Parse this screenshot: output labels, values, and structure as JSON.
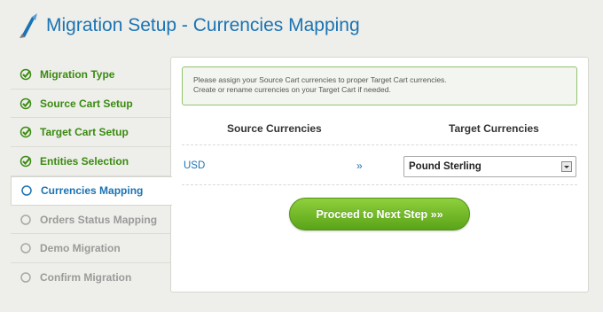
{
  "header": {
    "title": "Migration Setup - Currencies Mapping",
    "logo_icon": "arrow-pen-icon"
  },
  "steps": [
    {
      "label": "Migration Type",
      "state": "done",
      "icon": "check-circle-icon"
    },
    {
      "label": "Source Cart Setup",
      "state": "done",
      "icon": "check-circle-icon"
    },
    {
      "label": "Target Cart Setup",
      "state": "done",
      "icon": "check-circle-icon"
    },
    {
      "label": "Entities Selection",
      "state": "done",
      "icon": "check-circle-icon"
    },
    {
      "label": "Currencies Mapping",
      "state": "active",
      "icon": "circle-icon"
    },
    {
      "label": "Orders Status Mapping",
      "state": "pending",
      "icon": "circle-icon"
    },
    {
      "label": "Demo Migration",
      "state": "pending",
      "icon": "circle-icon"
    },
    {
      "label": "Confirm Migration",
      "state": "pending",
      "icon": "circle-icon"
    }
  ],
  "notice": {
    "line1": "Please assign your Source Cart currencies to proper Target Cart currencies.",
    "line2": "Create or rename currencies on your Target Cart if needed."
  },
  "table": {
    "source_header": "Source Currencies",
    "target_header": "Target Currencies",
    "rows": [
      {
        "source": "USD",
        "arrow": "»",
        "target": "Pound Sterling"
      }
    ]
  },
  "proceed_label": "Proceed to Next Step »»",
  "colors": {
    "accent_blue": "#1b73b3",
    "done_green": "#3a8a10",
    "button_green": "#6cb82a",
    "pending_gray": "#9a9a9a"
  }
}
